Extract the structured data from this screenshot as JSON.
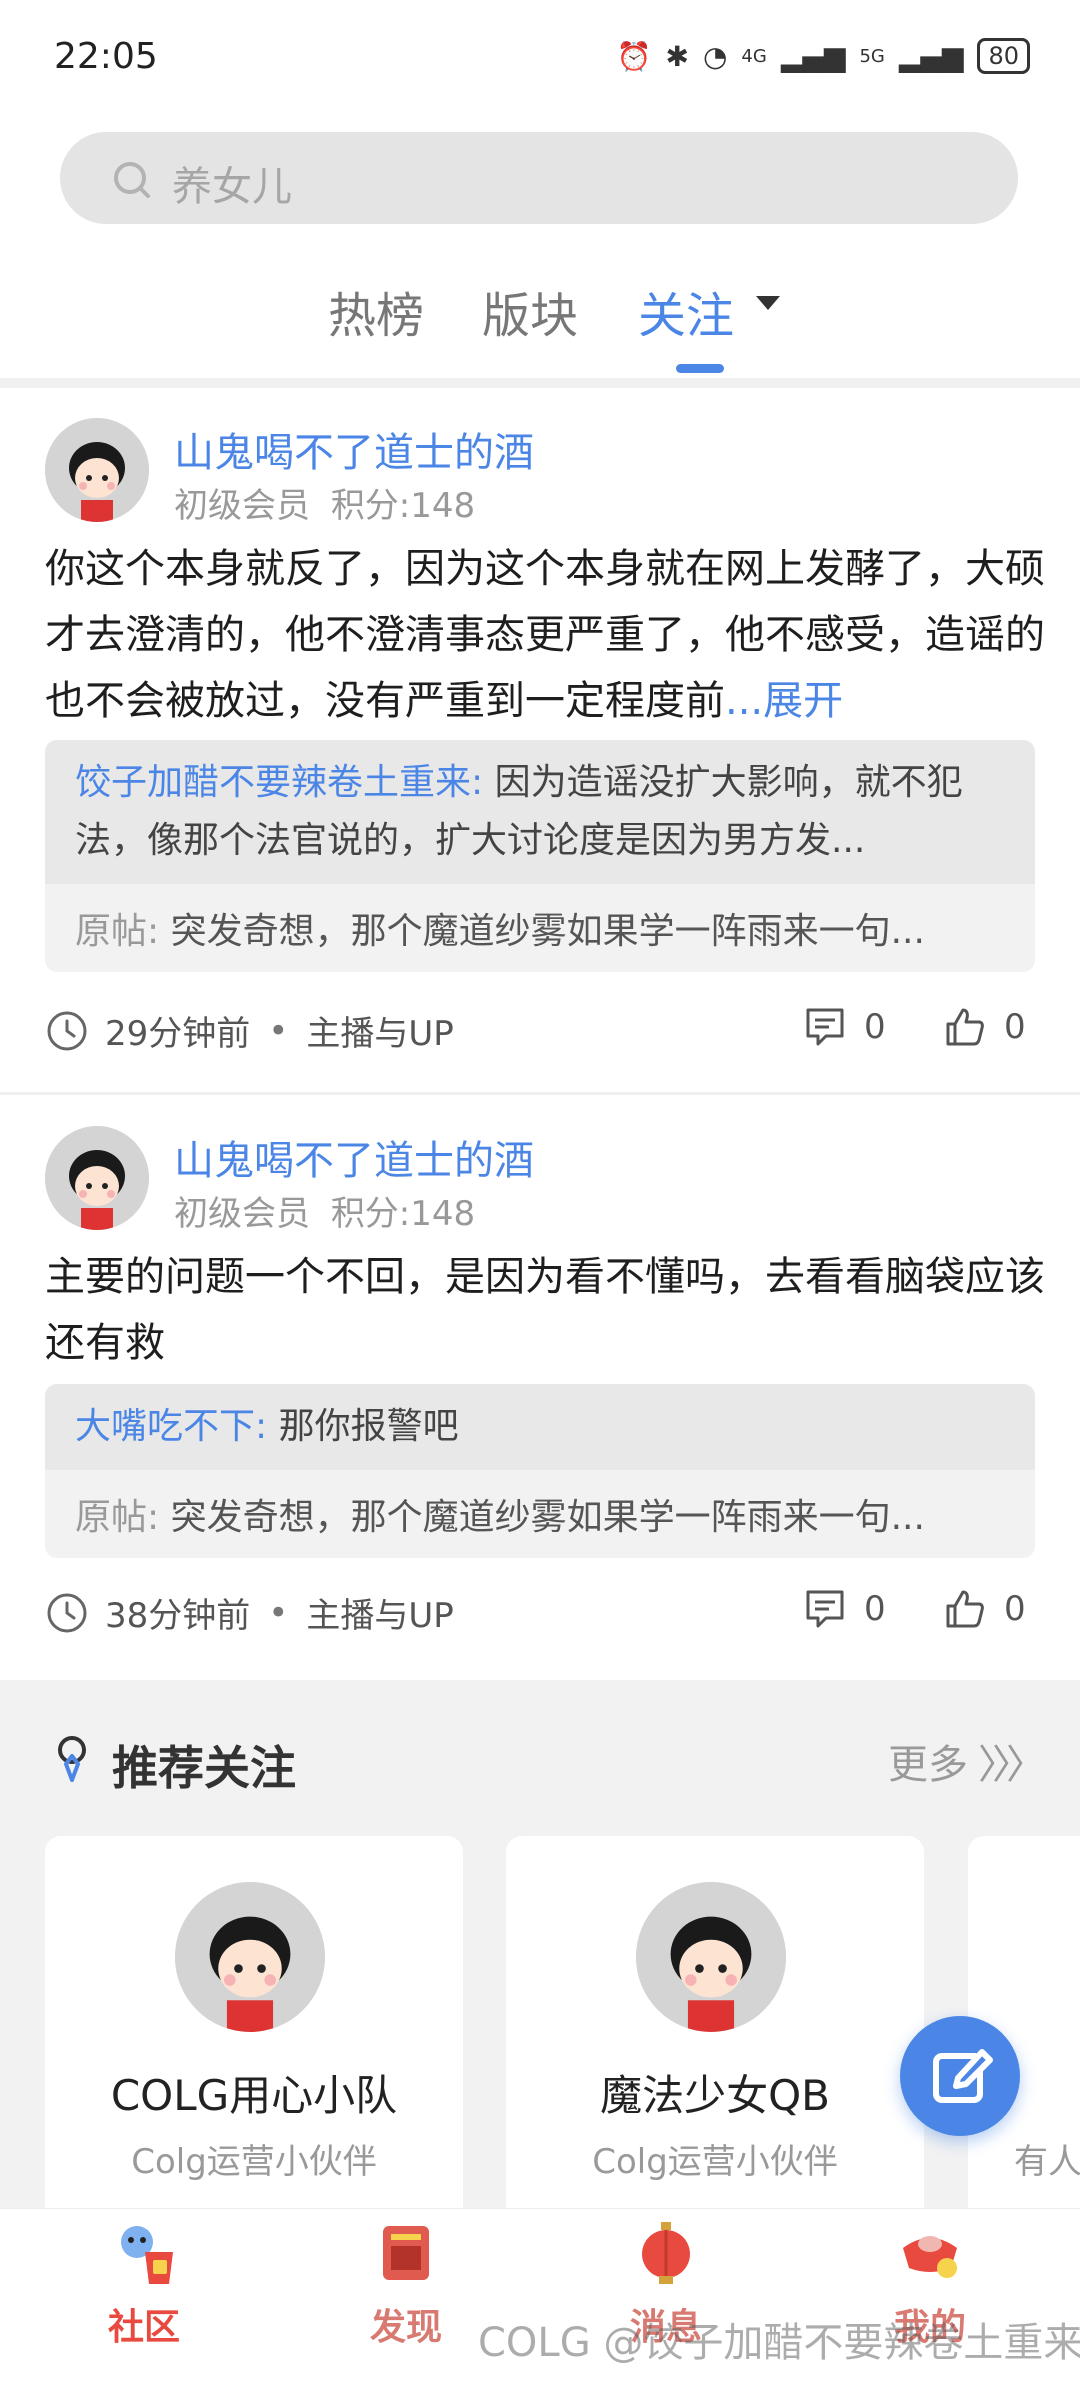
{
  "status_bar": {
    "time": "22:05",
    "network1": "4G",
    "network2": "5G",
    "battery": "80"
  },
  "search": {
    "placeholder": "养女儿"
  },
  "tabs": [
    {
      "label": "热榜"
    },
    {
      "label": "版块"
    },
    {
      "label": "关注"
    }
  ],
  "posts": [
    {
      "author": "山鬼喝不了道士的酒",
      "rank": "初级会员",
      "points": "积分:148",
      "text": "你这个本身就反了，因为这个本身就在网上发酵了，大硕才去澄清的，他不澄清事态更严重了，他不感受，造谣的也不会被放过，没有严重到一定程度前",
      "ellipsis": "...",
      "expand_label": "展开",
      "quote_user": "饺子加醋不要辣卷土重来:",
      "quote_text": "因为造谣没扩大影响，就不犯法，像那个法官说的，扩大讨论度是因为男方发...",
      "origin_label": "原帖:",
      "origin_text": "突发奇想，那个魔道纱雾如果学一阵雨来一句...",
      "time": "29分钟前",
      "dot": "•",
      "forum": "主播与UP",
      "comments": "0",
      "likes": "0"
    },
    {
      "author": "山鬼喝不了道士的酒",
      "rank": "初级会员",
      "points": "积分:148",
      "text": "主要的问题一个不回，是因为看不懂吗，去看看脑袋应该还有救",
      "quote_user": "大嘴吃不下:",
      "quote_text": "那你报警吧",
      "origin_label": "原帖:",
      "origin_text": "突发奇想，那个魔道纱雾如果学一阵雨来一句...",
      "time": "38分钟前",
      "dot": "•",
      "forum": "主播与UP",
      "comments": "0",
      "likes": "0"
    }
  ],
  "recommend": {
    "title": "推荐关注",
    "more_label": "更多",
    "cards": [
      {
        "name": "COLG用心小队",
        "desc": "Colg运营小伙伴"
      },
      {
        "name": "魔法少女QB",
        "desc": "Colg运营小伙伴"
      },
      {
        "name": "",
        "desc": "有人"
      }
    ]
  },
  "nav": [
    {
      "label": "社区",
      "color": "#e94a3f"
    },
    {
      "label": "发现",
      "color": "#d97a72"
    },
    {
      "label": "消息",
      "color": "#d97a72"
    },
    {
      "label": "我的",
      "color": "#d97a72"
    }
  ],
  "watermark": "COLG @饺子加醋不要辣卷土重来",
  "colors": {
    "accent": "#4b86e6",
    "nav_active": "#e94a3f"
  }
}
